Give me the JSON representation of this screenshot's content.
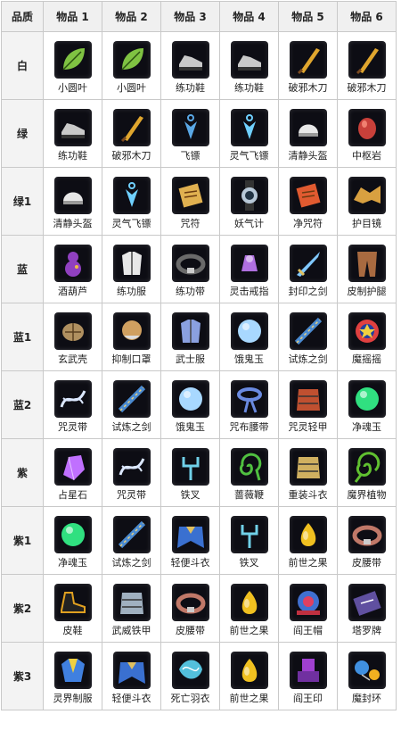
{
  "header": {
    "grade": "品质",
    "items": [
      "物品 1",
      "物品 2",
      "物品 3",
      "物品 4",
      "物品 5",
      "物品 6"
    ]
  },
  "rows": [
    {
      "grade": "白",
      "items": [
        {
          "name": "小圆叶",
          "icon": "leaf-icon",
          "color": "#7fc242"
        },
        {
          "name": "小圆叶",
          "icon": "leaf-icon",
          "color": "#7fc242"
        },
        {
          "name": "练功鞋",
          "icon": "shoe-icon",
          "color": "#c9c9c9"
        },
        {
          "name": "练功鞋",
          "icon": "shoe-icon",
          "color": "#c9c9c9"
        },
        {
          "name": "破邪木刀",
          "icon": "wooden-blade-icon",
          "color": "#e0a62e"
        },
        {
          "name": "破邪木刀",
          "icon": "wooden-blade-icon",
          "color": "#e0a62e"
        }
      ]
    },
    {
      "grade": "绿",
      "items": [
        {
          "name": "练功鞋",
          "icon": "shoe-icon",
          "color": "#c9c9c9"
        },
        {
          "name": "破邪木刀",
          "icon": "wooden-blade-icon",
          "color": "#e0a62e"
        },
        {
          "name": "飞镖",
          "icon": "dart-icon",
          "color": "#5aa8e6"
        },
        {
          "name": "灵气飞镖",
          "icon": "dart-icon",
          "color": "#6fd0ff"
        },
        {
          "name": "清静头盔",
          "icon": "helmet-icon",
          "color": "#e8e8e8"
        },
        {
          "name": "中枢岩",
          "icon": "stone-icon",
          "color": "#c8403a"
        }
      ]
    },
    {
      "grade": "绿1",
      "items": [
        {
          "name": "清静头盔",
          "icon": "helmet-icon",
          "color": "#e8e8e8"
        },
        {
          "name": "灵气飞镖",
          "icon": "dart-icon",
          "color": "#6fd0ff"
        },
        {
          "name": "咒符",
          "icon": "scroll-icon",
          "color": "#e0b050"
        },
        {
          "name": "妖气计",
          "icon": "gauge-icon",
          "color": "#b8c8d8"
        },
        {
          "name": "净咒符",
          "icon": "scroll-icon",
          "color": "#e05a30"
        },
        {
          "name": "护目镜",
          "icon": "goggles-icon",
          "color": "#d8a040"
        }
      ]
    },
    {
      "grade": "蓝",
      "items": [
        {
          "name": "酒葫芦",
          "icon": "gourd-icon",
          "color": "#9040c0"
        },
        {
          "name": "练功服",
          "icon": "robe-icon",
          "color": "#e8e8e8"
        },
        {
          "name": "练功带",
          "icon": "belt-icon",
          "color": "#6a6a6a"
        },
        {
          "name": "灵击戒指",
          "icon": "ring-icon",
          "color": "#b070e0"
        },
        {
          "name": "封印之剑",
          "icon": "sword-icon",
          "color": "#80c8ff"
        },
        {
          "name": "皮制护腿",
          "icon": "legguard-icon",
          "color": "#a86a40"
        }
      ]
    },
    {
      "grade": "蓝1",
      "items": [
        {
          "name": "玄武壳",
          "icon": "shell-icon",
          "color": "#b09060"
        },
        {
          "name": "抑制口罩",
          "icon": "mask-icon",
          "color": "#d0a060"
        },
        {
          "name": "武士服",
          "icon": "robe-icon",
          "color": "#8aa0e0"
        },
        {
          "name": "饿鬼玉",
          "icon": "orb-icon",
          "color": "#a8d8ff"
        },
        {
          "name": "试炼之剑",
          "icon": "scroll-sword-icon",
          "color": "#4a8ad0"
        },
        {
          "name": "魔摇摇",
          "icon": "yoyo-icon",
          "color": "#e04040"
        }
      ]
    },
    {
      "grade": "蓝2",
      "items": [
        {
          "name": "咒灵带",
          "icon": "ribbon-icon",
          "color": "#dce8ff"
        },
        {
          "name": "试炼之剑",
          "icon": "scroll-sword-icon",
          "color": "#4a8ad0"
        },
        {
          "name": "饿鬼玉",
          "icon": "orb-icon",
          "color": "#a8d8ff"
        },
        {
          "name": "咒布腰带",
          "icon": "sash-icon",
          "color": "#6a8ae0"
        },
        {
          "name": "咒灵轻甲",
          "icon": "armor-icon",
          "color": "#c05030"
        },
        {
          "name": "净魂玉",
          "icon": "orb-icon",
          "color": "#30e080"
        }
      ]
    },
    {
      "grade": "紫",
      "items": [
        {
          "name": "占星石",
          "icon": "crystal-icon",
          "color": "#c070ff"
        },
        {
          "name": "咒灵带",
          "icon": "ribbon-icon",
          "color": "#dce8ff"
        },
        {
          "name": "铁叉",
          "icon": "fork-icon",
          "color": "#70d0e8"
        },
        {
          "name": "蔷薇鞭",
          "icon": "whip-icon",
          "color": "#50c040"
        },
        {
          "name": "重装斗衣",
          "icon": "armor-icon",
          "color": "#d0b060"
        },
        {
          "name": "魔界植物",
          "icon": "plant-icon",
          "color": "#60c030"
        }
      ]
    },
    {
      "grade": "紫1",
      "items": [
        {
          "name": "净魂玉",
          "icon": "orb-icon",
          "color": "#30e080"
        },
        {
          "name": "试炼之剑",
          "icon": "scroll-sword-icon",
          "color": "#4a8ad0"
        },
        {
          "name": "轻便斗衣",
          "icon": "cape-icon",
          "color": "#3a70d0"
        },
        {
          "name": "铁叉",
          "icon": "fork-icon",
          "color": "#70d0e8"
        },
        {
          "name": "前世之果",
          "icon": "fruit-icon",
          "color": "#f0c020"
        },
        {
          "name": "皮腰带",
          "icon": "belt-icon",
          "color": "#c07868"
        }
      ]
    },
    {
      "grade": "紫2",
      "items": [
        {
          "name": "皮鞋",
          "icon": "boot-icon",
          "color": "#e0a020"
        },
        {
          "name": "武威铁甲",
          "icon": "armor-icon",
          "color": "#a0b0c0"
        },
        {
          "name": "皮腰带",
          "icon": "belt-icon",
          "color": "#c07868"
        },
        {
          "name": "前世之果",
          "icon": "fruit-icon",
          "color": "#f0c020"
        },
        {
          "name": "阎王帽",
          "icon": "hat-icon",
          "color": "#e04060"
        },
        {
          "name": "塔罗牌",
          "icon": "card-icon",
          "color": "#6050a0"
        }
      ]
    },
    {
      "grade": "紫3",
      "items": [
        {
          "name": "灵界制服",
          "icon": "uniform-icon",
          "color": "#4080e0"
        },
        {
          "name": "轻便斗衣",
          "icon": "cape-icon",
          "color": "#3a70d0"
        },
        {
          "name": "死亡羽衣",
          "icon": "feather-robe-icon",
          "color": "#60e0ff"
        },
        {
          "name": "前世之果",
          "icon": "fruit-icon",
          "color": "#f0c020"
        },
        {
          "name": "阎王印",
          "icon": "seal-icon",
          "color": "#a040d0"
        },
        {
          "name": "魔封环",
          "icon": "rings-icon",
          "color": "#4090e0"
        }
      ]
    }
  ]
}
